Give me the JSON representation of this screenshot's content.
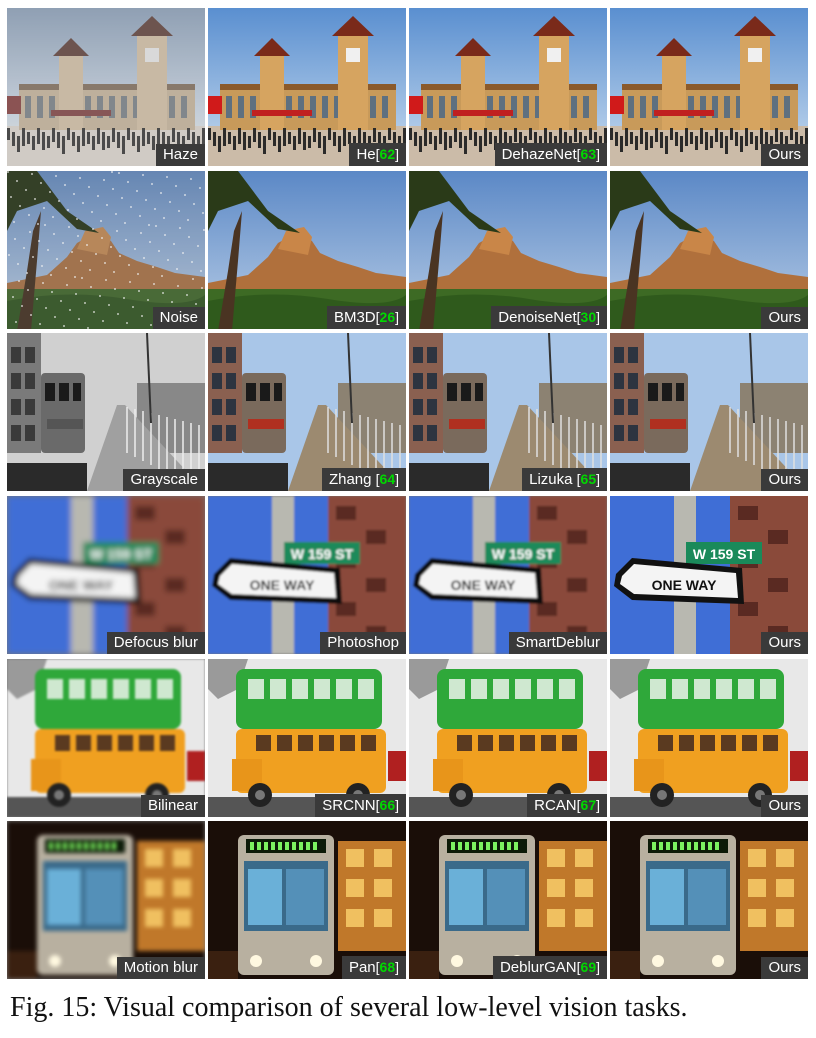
{
  "caption": "Fig. 15: Visual comparison of several low-level vision tasks.",
  "rows": [
    {
      "scene": "station",
      "tiles": [
        {
          "label": "Haze",
          "ref": ""
        },
        {
          "label": "He",
          "ref": "62"
        },
        {
          "label": "DehazeNet",
          "ref": "63"
        },
        {
          "label": "Ours",
          "ref": ""
        }
      ]
    },
    {
      "scene": "desert",
      "tiles": [
        {
          "label": "Noise",
          "ref": ""
        },
        {
          "label": "BM3D",
          "ref": "26"
        },
        {
          "label": "DenoiseNet",
          "ref": "30"
        },
        {
          "label": "Ours",
          "ref": ""
        }
      ]
    },
    {
      "scene": "train",
      "tiles": [
        {
          "label": "Grayscale",
          "ref": ""
        },
        {
          "label": "Zhang ",
          "ref": "64"
        },
        {
          "label": "Lizuka ",
          "ref": "65"
        },
        {
          "label": "Ours",
          "ref": ""
        }
      ]
    },
    {
      "scene": "sign",
      "sign_text": "ONE WAY",
      "street_text": "W 159 ST",
      "tiles": [
        {
          "label": "Defocus blur",
          "ref": ""
        },
        {
          "label": "Photoshop",
          "ref": ""
        },
        {
          "label": "SmartDeblur",
          "ref": ""
        },
        {
          "label": "Ours",
          "ref": ""
        }
      ]
    },
    {
      "scene": "bus",
      "tiles": [
        {
          "label": "Bilinear",
          "ref": ""
        },
        {
          "label": "SRCNN",
          "ref": "66"
        },
        {
          "label": "RCAN",
          "ref": "67"
        },
        {
          "label": "Ours",
          "ref": ""
        }
      ]
    },
    {
      "scene": "nightbus",
      "tiles": [
        {
          "label": "Motion blur",
          "ref": ""
        },
        {
          "label": "Pan",
          "ref": "68"
        },
        {
          "label": "DeblurGAN",
          "ref": "69"
        },
        {
          "label": "Ours",
          "ref": ""
        }
      ]
    }
  ]
}
